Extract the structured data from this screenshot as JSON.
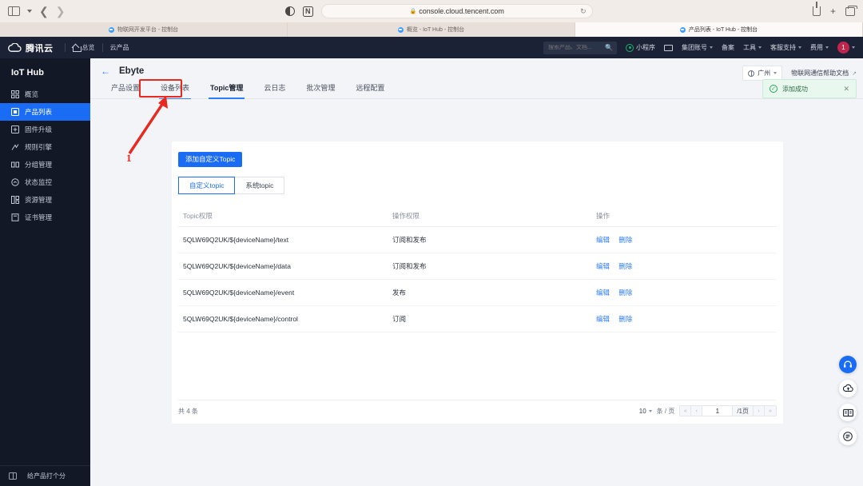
{
  "browser": {
    "url": "console.cloud.tencent.com",
    "lock_icon": "lock-icon",
    "reload_icon": "reload-icon",
    "back_icon": "back-arrow-icon",
    "forward_icon": "forward-arrow-icon",
    "sidebar_icon": "sidebar-toggle-icon",
    "reader_icon": "reader-mode-icon",
    "extension_icon": "notion-extension-icon",
    "share_icon": "share-icon",
    "newtab_icon": "new-tab-icon",
    "tabs_icon": "tab-overview-icon",
    "tabs": [
      {
        "title": "物联网开发平台 - 控制台",
        "active": false
      },
      {
        "title": "概览 - IoT Hub - 控制台",
        "active": false
      },
      {
        "title": "产品列表 - IoT Hub - 控制台",
        "active": true
      }
    ]
  },
  "header": {
    "brand": "腾讯云",
    "home_label": "总览",
    "products_label": "云产品",
    "search_placeholder": "搜索产品、文档...",
    "search_value": "",
    "items": [
      {
        "label": "小程序",
        "icon": "miniprogram-icon",
        "caret": false
      },
      {
        "label": "",
        "icon": "mail-icon",
        "caret": false
      },
      {
        "label": "集团账号",
        "icon": "",
        "caret": true
      },
      {
        "label": "备案",
        "icon": "",
        "caret": false
      },
      {
        "label": "工具",
        "icon": "",
        "caret": true
      },
      {
        "label": "客服支持",
        "icon": "",
        "caret": true
      },
      {
        "label": "费用",
        "icon": "",
        "caret": true
      }
    ],
    "avatar_text": "1"
  },
  "sidebar": {
    "title": "IoT Hub",
    "items": [
      {
        "label": "概览",
        "icon": "dashboard-icon",
        "active": false
      },
      {
        "label": "产品列表",
        "icon": "product-icon",
        "active": true
      },
      {
        "label": "固件升级",
        "icon": "firmware-icon",
        "active": false
      },
      {
        "label": "规则引擎",
        "icon": "rule-engine-icon",
        "active": false
      },
      {
        "label": "分组管理",
        "icon": "group-icon",
        "active": false
      },
      {
        "label": "状态监控",
        "icon": "monitor-icon",
        "active": false
      },
      {
        "label": "资源管理",
        "icon": "resource-icon",
        "active": false
      },
      {
        "label": "证书管理",
        "icon": "certificate-icon",
        "active": false
      }
    ],
    "footer_label": "给产品打个分",
    "footer_icon": "rating-icon",
    "collapse_icon": "collapse-sidebar-icon"
  },
  "main": {
    "back_icon": "back-arrow-icon",
    "page_title": "Ebyte",
    "tabs": [
      {
        "label": "产品设置",
        "active": false,
        "highlighted": false
      },
      {
        "label": "设备列表",
        "active": false,
        "highlighted": true
      },
      {
        "label": "Topic管理",
        "active": true,
        "highlighted": false
      },
      {
        "label": "云日志",
        "active": false,
        "highlighted": false
      },
      {
        "label": "批次管理",
        "active": false,
        "highlighted": false
      },
      {
        "label": "远程配置",
        "active": false,
        "highlighted": false
      }
    ],
    "add_topic_button": "添加自定义Topic",
    "segments": [
      {
        "label": "自定义topic",
        "active": true
      },
      {
        "label": "系统topic",
        "active": false
      }
    ],
    "table": {
      "columns": [
        "Topic权限",
        "操作权限",
        "操作"
      ],
      "rows": [
        {
          "topic": "5QLW69Q2UK/${deviceName}/text",
          "permission": "订阅和发布",
          "actions": [
            "编辑",
            "删除"
          ]
        },
        {
          "topic": "5QLW69Q2UK/${deviceName}/data",
          "permission": "订阅和发布",
          "actions": [
            "编辑",
            "删除"
          ]
        },
        {
          "topic": "5QLW69Q2UK/${deviceName}/event",
          "permission": "发布",
          "actions": [
            "编辑",
            "删除"
          ]
        },
        {
          "topic": "5QLW69Q2UK/${deviceName}/control",
          "permission": "订阅",
          "actions": [
            "编辑",
            "删除"
          ]
        }
      ]
    },
    "pagination": {
      "total_text": "共 4 条",
      "page_size": "10",
      "page_size_unit": "条 / 页",
      "current_page": "1",
      "total_pages_text": "/1页",
      "first_icon": "first-page-icon",
      "prev_icon": "prev-page-icon",
      "next_icon": "next-page-icon",
      "last_icon": "last-page-icon"
    }
  },
  "region": {
    "label": "广州",
    "globe_icon": "globe-icon",
    "caret_icon": "chevron-down-icon",
    "doc_link": "物联网通信帮助文档",
    "doc_ext_icon": "external-link-icon"
  },
  "toast": {
    "message": "添加成功",
    "check_icon": "success-check-icon",
    "close_icon": "close-icon"
  },
  "floats": [
    {
      "icon": "headset-support-icon",
      "primary": true
    },
    {
      "icon": "cloud-upload-icon",
      "primary": false
    },
    {
      "icon": "book-docs-icon",
      "primary": false
    },
    {
      "icon": "list-menu-icon",
      "primary": false
    }
  ],
  "annotations": {
    "step_number": "1",
    "arrow_icon": "red-arrow-icon",
    "box_icon": "red-highlight-box",
    "accent_color": "#e8291f"
  }
}
